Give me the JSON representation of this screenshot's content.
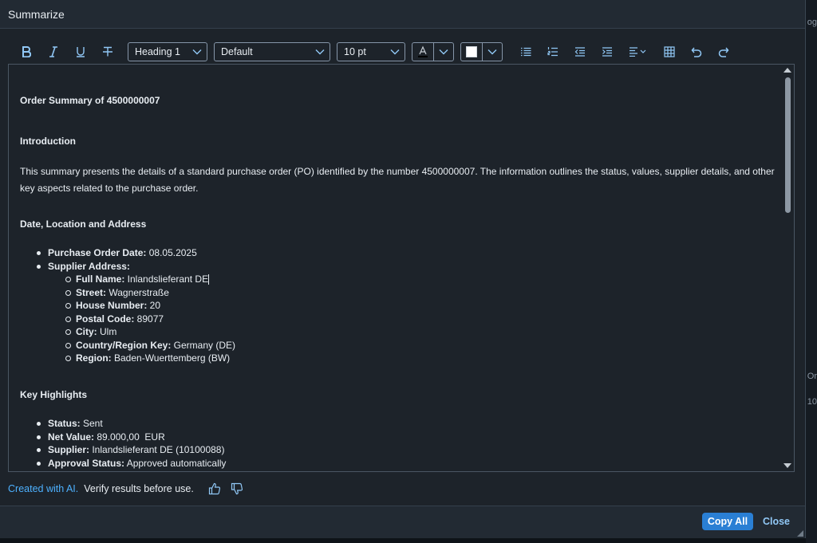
{
  "dialog": {
    "title": "Summarize"
  },
  "toolbar": {
    "heading_select": "Heading 1",
    "font_select": "Default",
    "size_select": "10 pt"
  },
  "doc": {
    "title": "Order Summary of 4500000007",
    "sections": {
      "intro_heading": "Introduction",
      "intro_text": "This summary presents the details of a standard purchase order (PO) identified by the number 4500000007. The information outlines the status, values, supplier details, and other key aspects related to the purchase order.",
      "address_heading": "Date, Location and Address",
      "highlights_heading": "Key Highlights"
    },
    "address_list": {
      "po_date_label": "Purchase Order Date:",
      "po_date_value": " 08.05.2025",
      "supplier_address_label": "Supplier Address:",
      "sub_items": [
        {
          "label": "Full Name:",
          "value": " Inlandslieferant DE"
        },
        {
          "label": "Street:",
          "value": " Wagnerstraße"
        },
        {
          "label": "House Number:",
          "value": " 20"
        },
        {
          "label": "Postal Code:",
          "value": " 89077"
        },
        {
          "label": "City:",
          "value": " Ulm"
        },
        {
          "label": "Country/Region Key:",
          "value": " Germany (DE)"
        },
        {
          "label": "Region:",
          "value": " Baden-Wuerttemberg (BW)"
        }
      ]
    },
    "highlights": [
      {
        "label": "Status:",
        "value": " Sent"
      },
      {
        "label": "Net Value:",
        "value": " 89.000,00  EUR"
      },
      {
        "label": "Supplier:",
        "value": " Inlandslieferant DE (10100088)"
      },
      {
        "label": "Approval Status:",
        "value": " Approved automatically"
      }
    ]
  },
  "ai_notice": {
    "link": "Created with AI.",
    "note": "Verify results before use."
  },
  "footer": {
    "copy_all": "Copy All",
    "close": "Close"
  },
  "background": {
    "frag_top": "og",
    "frag_mid": "Or",
    "frag_low": "10"
  },
  "colors": {
    "accent": "#2a7fd4",
    "icon": "#91c8f6",
    "bg": "#1d232a"
  }
}
